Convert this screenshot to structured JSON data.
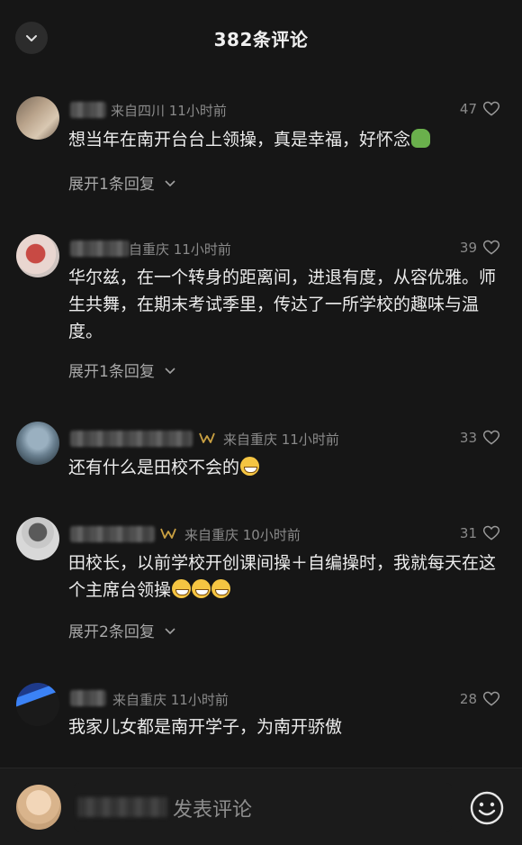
{
  "header": {
    "title": "382条评论"
  },
  "comments": [
    {
      "meta": "来自四川 11小时前",
      "likes": "47",
      "text": "想当年在南开台台上领操，真是幸福，好怀念",
      "expand": "展开1条回复"
    },
    {
      "meta": "自重庆 11小时前",
      "likes": "39",
      "text": "华尔兹，在一个转身的距离间，进退有度，从容优雅。师生共舞，在期末考试季里，传达了一所学校的趣味与温度。",
      "expand": "展开1条回复"
    },
    {
      "meta": "来自重庆 11小时前",
      "likes": "33",
      "text": "还有什么是田校不会的"
    },
    {
      "meta": "来自重庆 10小时前",
      "likes": "31",
      "text": "田校长，以前学校开创课间操＋自编操时，我就每天在这个主席台领操",
      "expand": "展开2条回复"
    },
    {
      "meta": "来自重庆 11小时前",
      "likes": "28",
      "text": "我家儿女都是南开学子，为南开骄傲"
    }
  ],
  "composer": {
    "placeholder": "发表评论"
  },
  "icons": {
    "back": "chevron-down-icon",
    "like": "heart-outline-icon",
    "expand": "chevron-down-icon",
    "emoji": "smiley-icon",
    "badge": "crown-badge-icon"
  },
  "colors": {
    "background": "#161616",
    "badge": "#c9a042"
  }
}
